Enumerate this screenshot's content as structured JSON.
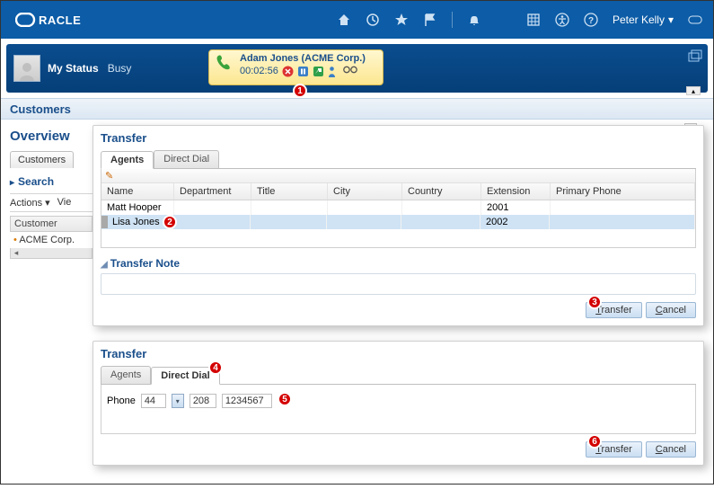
{
  "brand": "ORACLE",
  "user": {
    "name": "Peter Kelly"
  },
  "status": {
    "label": "My Status",
    "value": "Busy"
  },
  "call": {
    "contact": "Adam Jones (ACME Corp.)",
    "time": "00:02:56"
  },
  "page": {
    "title": "Customers"
  },
  "sidebar": {
    "overview": "Overview",
    "tab_customers": "Customers",
    "search": "Search",
    "actions_label": "Actions",
    "view_label": "Vie",
    "col_customer": "Customer",
    "row0": "ACME Corp."
  },
  "transfer1": {
    "title": "Transfer",
    "tab_agents": "Agents",
    "tab_direct": "Direct Dial",
    "cols": {
      "name": "Name",
      "dept": "Department",
      "title": "Title",
      "city": "City",
      "country": "Country",
      "ext": "Extension",
      "phone": "Primary Phone"
    },
    "rows": [
      {
        "name": "Matt Hooper",
        "dept": "",
        "title": "",
        "city": "",
        "country": "",
        "ext": "2001",
        "phone": ""
      },
      {
        "name": "Lisa Jones",
        "dept": "",
        "title": "",
        "city": "",
        "country": "",
        "ext": "2002",
        "phone": ""
      }
    ],
    "note_header": "Transfer Note",
    "transfer_btn": "Transfer",
    "cancel_btn": "Cancel"
  },
  "transfer2": {
    "title": "Transfer",
    "tab_agents": "Agents",
    "tab_direct": "Direct Dial",
    "phone_label": "Phone",
    "cc": "44",
    "ac": "208",
    "num": "1234567",
    "transfer_btn": "Transfer",
    "cancel_btn": "Cancel"
  },
  "badges": {
    "b1": "1",
    "b2": "2",
    "b3": "3",
    "b4": "4",
    "b5": "5",
    "b6": "6"
  }
}
